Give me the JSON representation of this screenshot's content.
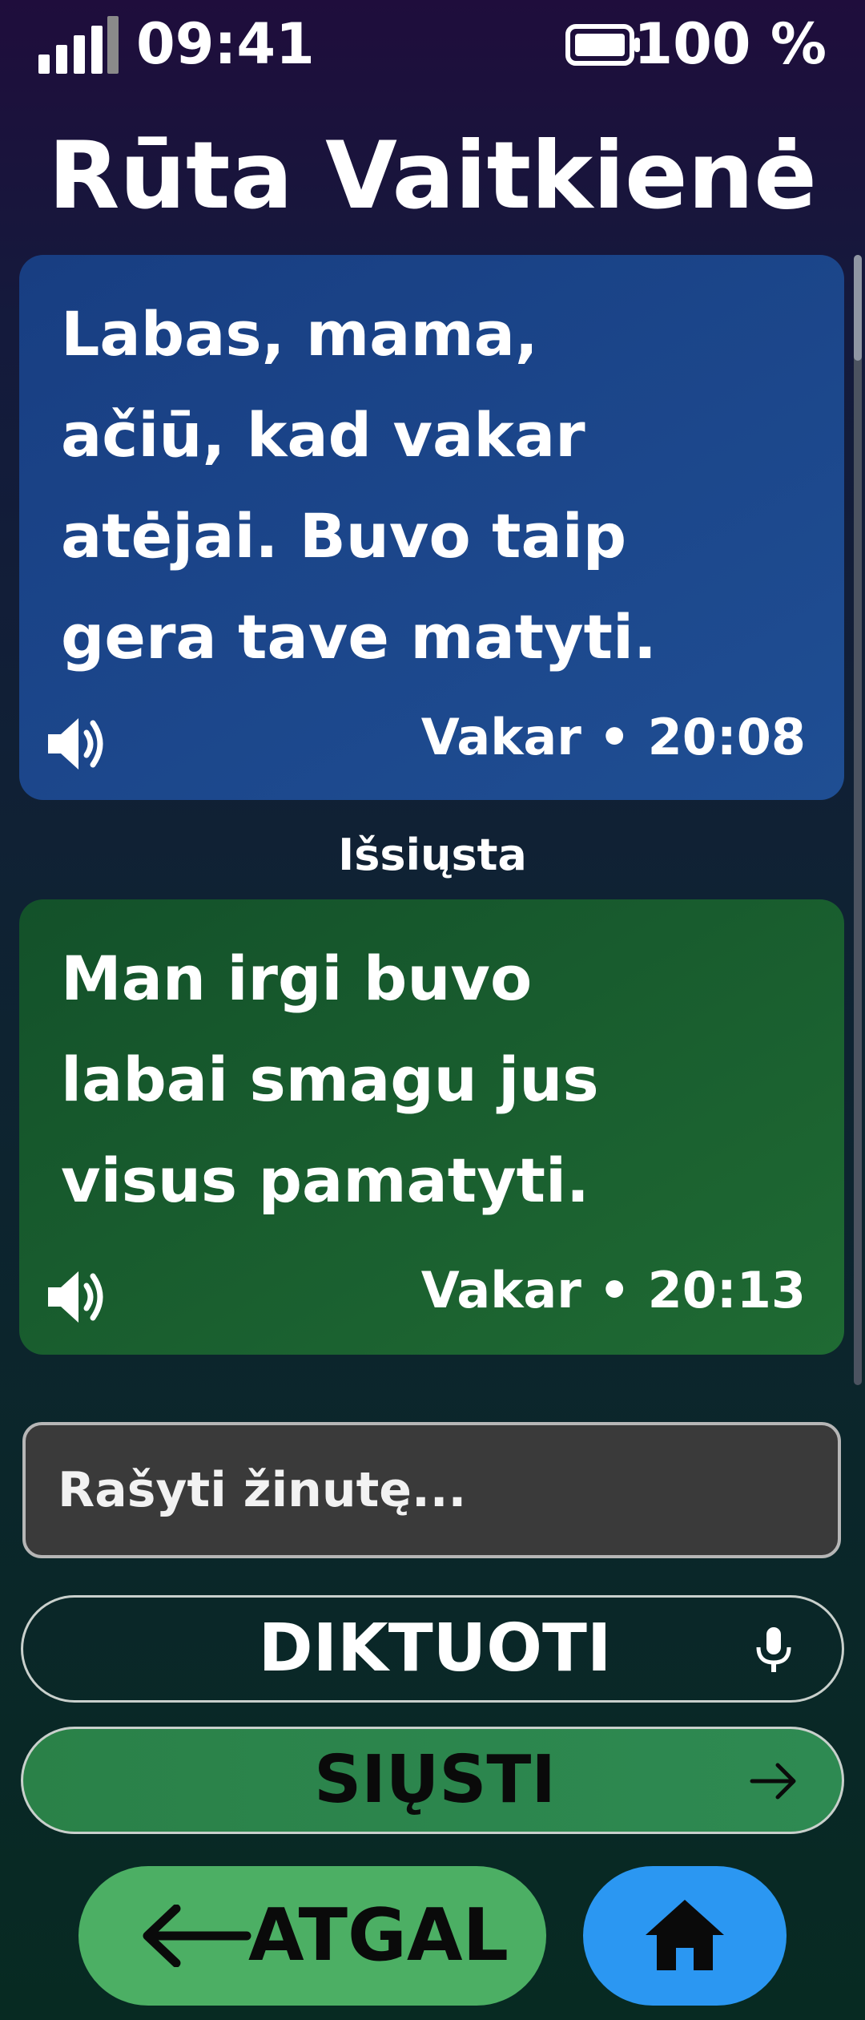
{
  "status_bar": {
    "time": "09:41",
    "battery": "100 %"
  },
  "contact": {
    "name": "Rūta Vaitkienė"
  },
  "messages": [
    {
      "direction": "incoming",
      "text": "Labas, mama, ačiū, kad vakar atėjai. Buvo taip gera tave matyti.",
      "time": "Vakar • 20:08",
      "icon": "speaker-icon",
      "color": "#1d4a8f"
    },
    {
      "direction": "outgoing",
      "text": "Man irgi buvo labai smagu jus visus pamatyti.",
      "time": "Vakar • 20:13",
      "icon": "speaker-icon",
      "color": "#1b6330"
    }
  ],
  "sent_label": "Išsiųsta",
  "compose": {
    "placeholder": "Rašyti žinutę..."
  },
  "buttons": {
    "dictate": {
      "label": "DIKTUOTI",
      "icon": "microphone-icon"
    },
    "send": {
      "label": "SIŲSTI",
      "icon": "arrow-right-icon",
      "color": "#2e8a52"
    },
    "back": {
      "label": "ATGAL",
      "icon": "arrow-left-icon",
      "color": "#4caf64"
    },
    "home": {
      "icon": "home-icon",
      "color": "#2b97f2"
    }
  }
}
